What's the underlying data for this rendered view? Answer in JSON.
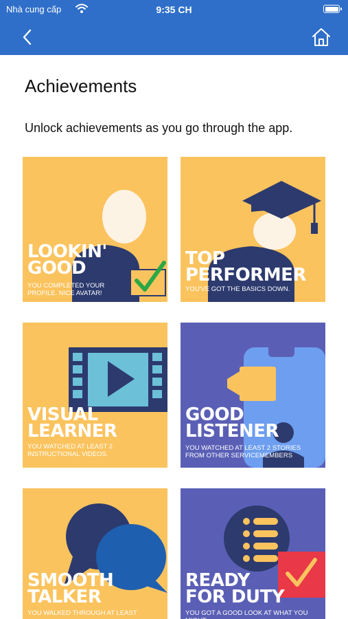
{
  "status": {
    "carrier": "Nhà cung cấp",
    "time": "9:35 CH"
  },
  "nav": {
    "back_icon": "chevron-left-icon",
    "home_icon": "home-icon"
  },
  "page": {
    "title": "Achievements",
    "subtitle": "Unlock achievements as you go through the app."
  },
  "colors": {
    "nav_blue": "#2f6fc9",
    "card_yellow": "#fbc35e",
    "card_purple": "#5a5fb5",
    "navy": "#2c3a6e"
  },
  "achievements": [
    {
      "title": "LOOKIN'\nGOOD",
      "description": "YOU COMPLETED YOUR\nPROFILE. NICE AVATAR!"
    },
    {
      "title": "TOP\nPERFORMER",
      "description": "YOU'VE GOT THE BASICS DOWN."
    },
    {
      "title": "VISUAL\nLEARNER",
      "description": "YOU WATCHED AT LEAST 2\nINSTRUCTIONAL VIDEOS."
    },
    {
      "title": "GOOD\nLISTENER",
      "description": "YOU WATCHED AT LEAST 2 STORIES\nFROM OTHER SERVICEMEMBERS"
    },
    {
      "title": "SMOOTH\nTALKER",
      "description": "YOU WALKED THROUGH AT LEAST"
    },
    {
      "title": "READY\nFOR DUTY",
      "description": "YOU GOT A GOOD LOOK AT WHAT YOU  MIGHT"
    }
  ]
}
